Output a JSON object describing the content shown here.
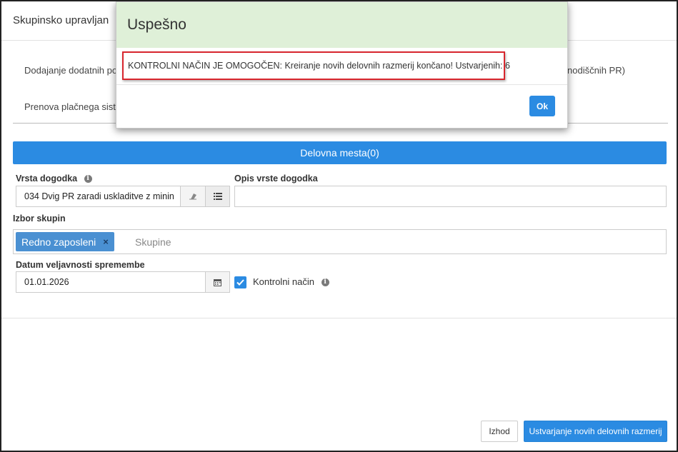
{
  "header": {
    "title": "Skupinsko upravljan"
  },
  "options": {
    "add_text": "Dodajanje dodatnih po",
    "add_text_right": "nodiščnih PR)",
    "renew_text": "Prenova plačnega siste"
  },
  "positions_bar": {
    "label": "Delovna mesta(0)"
  },
  "event_type": {
    "label": "Vrsta dogodka",
    "value": "034 Dvig PR zaradi uskladitve z minin"
  },
  "event_desc": {
    "label": "Opis vrste dogodka",
    "value": ""
  },
  "groups": {
    "label": "Izbor skupin",
    "selected": "Redno zaposleni",
    "placeholder": "Skupine"
  },
  "date": {
    "label": "Datum veljavnosti spremembe",
    "value": "01.01.2026"
  },
  "control_mode": {
    "label": "Kontrolni način",
    "checked": true
  },
  "footer": {
    "exit_label": "Izhod",
    "create_label": "Ustvarjanje novih delovnih razmerij"
  },
  "modal": {
    "title": "Uspešno",
    "message": "KONTROLNI NAČIN JE OMOGOČEN: Kreiranje novih delovnih razmerij končano! Ustvarjenih: 6",
    "ok_label": "Ok",
    "header_color": "#dff0d8"
  },
  "colors": {
    "accent": "#2b8be2",
    "highlight": "#d8262e"
  },
  "icons": [
    "info-icon",
    "eraser-icon",
    "list-icon",
    "calendar-icon",
    "check-icon",
    "remove-tag-icon"
  ]
}
